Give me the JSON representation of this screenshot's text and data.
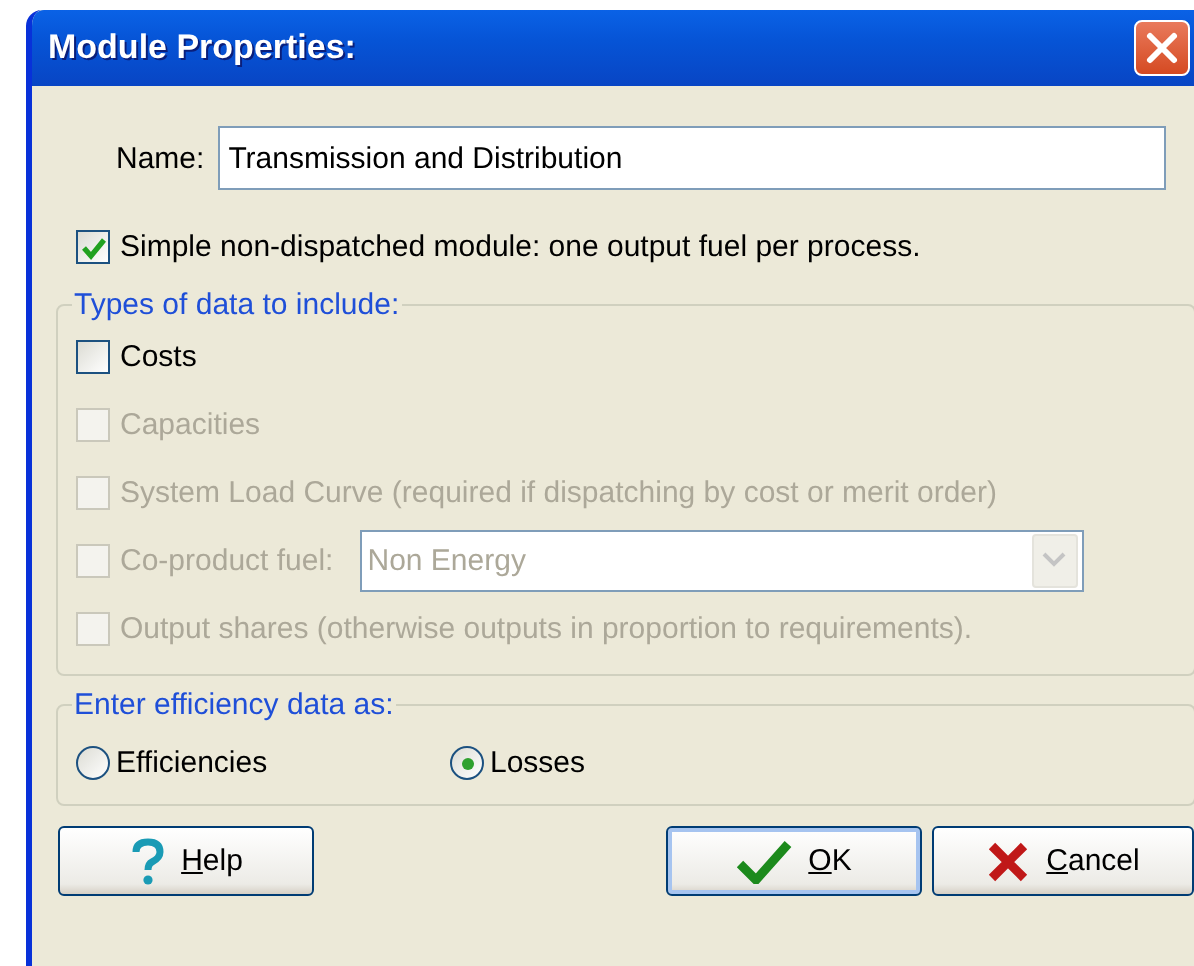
{
  "window": {
    "title": "Module Properties:"
  },
  "name_field": {
    "label": "Name:",
    "value": "Transmission and Distribution"
  },
  "simple_module": {
    "label": "Simple non-dispatched module: one output fuel per process.",
    "checked": true
  },
  "data_types": {
    "title": "Types of data to include:",
    "items": [
      {
        "kind": "checkbox",
        "label": "Costs",
        "checked": false,
        "disabled": false
      },
      {
        "kind": "checkbox",
        "label": "Capacities",
        "checked": false,
        "disabled": true
      },
      {
        "kind": "checkbox",
        "label": "System Load Curve (required if dispatching by cost or merit order)",
        "checked": false,
        "disabled": true
      },
      {
        "kind": "combo",
        "label": "Co-product fuel:",
        "checked": false,
        "disabled": true,
        "value": "Non Energy"
      },
      {
        "kind": "checkbox",
        "label": "Output shares (otherwise outputs in proportion to requirements).",
        "checked": false,
        "disabled": true
      }
    ]
  },
  "efficiency": {
    "title": "Enter efficiency data as:",
    "options": [
      {
        "label": "Efficiencies",
        "selected": false
      },
      {
        "label": "Losses",
        "selected": true
      }
    ]
  },
  "buttons": [
    {
      "kind": "help",
      "label": "Help",
      "default": false
    },
    {
      "kind": "ok",
      "label": "OK",
      "default": true
    },
    {
      "kind": "cancel",
      "label": "Cancel",
      "default": false
    }
  ]
}
